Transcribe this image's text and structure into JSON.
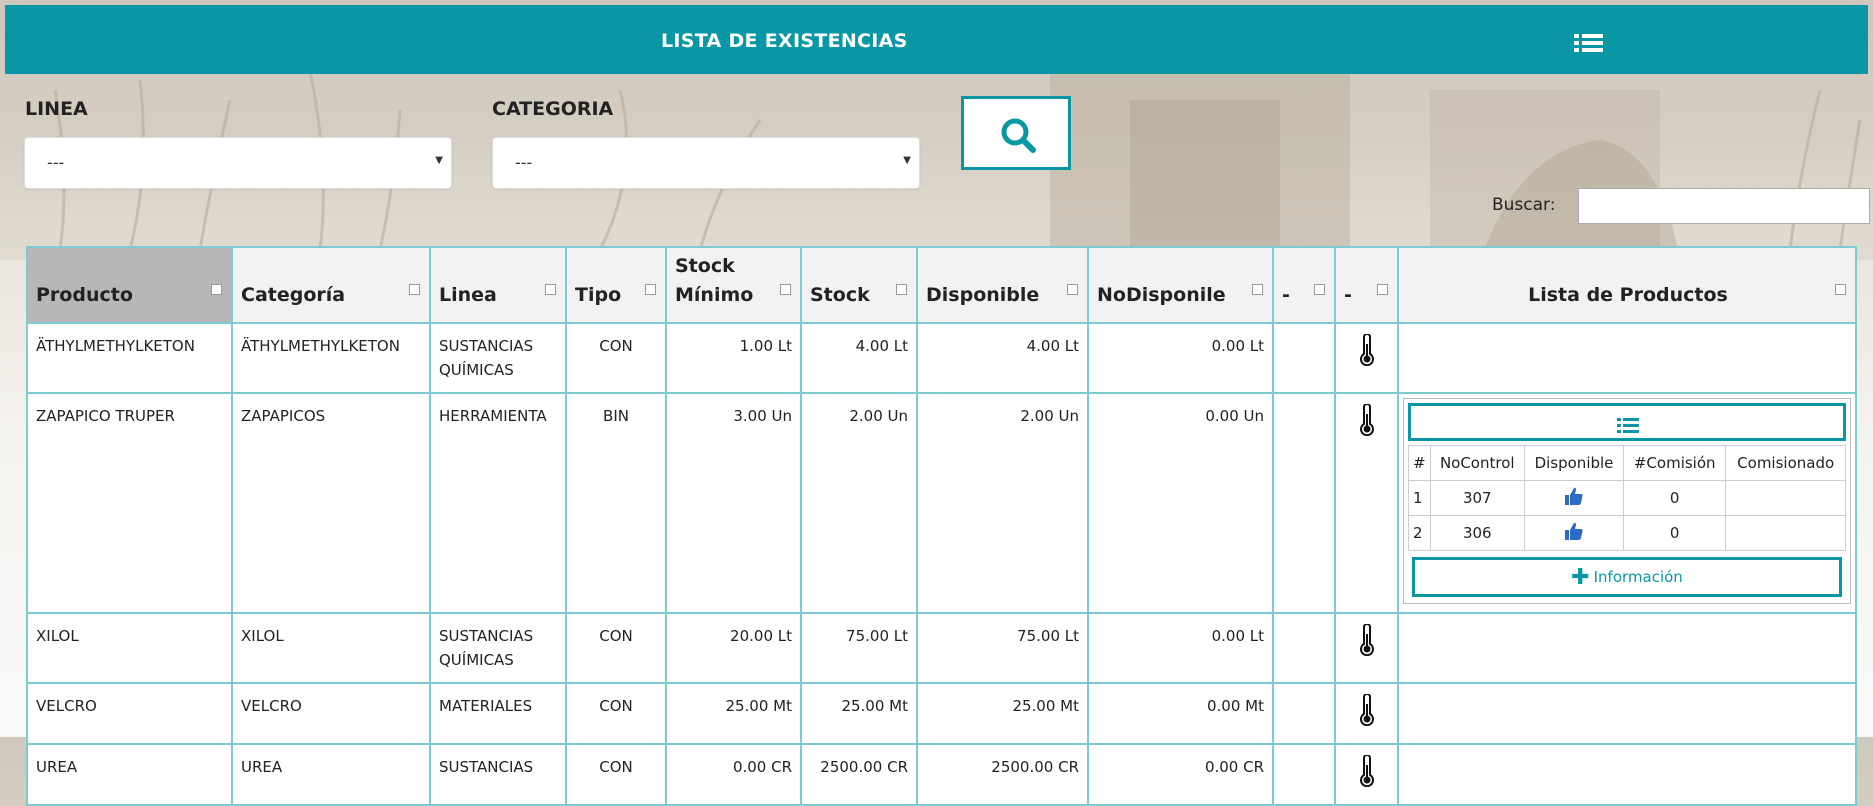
{
  "header": {
    "title": "LISTA DE EXISTENCIAS",
    "menu_icon": "list-icon",
    "accent": "#0a97a5"
  },
  "filters": {
    "linea": {
      "label": "LINEA",
      "value": "---"
    },
    "categoria": {
      "label": "CATEGORIA",
      "value": "---"
    },
    "search_icon": "search-icon"
  },
  "buscar": {
    "label": "Buscar:",
    "value": ""
  },
  "columns": [
    "Producto",
    "Categoría",
    "Linea",
    "Tipo",
    "Stock Mínimo",
    "Stock",
    "Disponible",
    "NoDisponile",
    "-",
    "-",
    "Lista de Productos"
  ],
  "rows": [
    {
      "producto": "ÄTHYLMETHYLKETON",
      "categoria": "ÄTHYLMETHYLKETON",
      "linea": "SUSTANCIAS QUÍMICAS",
      "tipo": "CON",
      "stock_minimo": "1.00 Lt",
      "stock": "4.00 Lt",
      "disponible": "4.00 Lt",
      "nodisponible": "0.00 Lt",
      "status": "green"
    },
    {
      "producto": "ZAPAPICO TRUPER",
      "categoria": "ZAPAPICOS",
      "linea": "HERRAMIENTA",
      "tipo": "BIN",
      "stock_minimo": "3.00 Un",
      "stock": "2.00 Un",
      "disponible": "2.00 Un",
      "nodisponible": "0.00 Un",
      "status": "red"
    },
    {
      "producto": "XILOL",
      "categoria": "XILOL",
      "linea": "SUSTANCIAS QUÍMICAS",
      "tipo": "CON",
      "stock_minimo": "20.00 Lt",
      "stock": "75.00 Lt",
      "disponible": "75.00 Lt",
      "nodisponible": "0.00 Lt",
      "status": "green"
    },
    {
      "producto": "VELCRO",
      "categoria": "VELCRO",
      "linea": "MATERIALES",
      "tipo": "CON",
      "stock_minimo": "25.00 Mt",
      "stock": "25.00 Mt",
      "disponible": "25.00 Mt",
      "nodisponible": "0.00 Mt",
      "status": "yellow"
    },
    {
      "producto": "UREA",
      "categoria": "UREA",
      "linea": "SUSTANCIAS",
      "tipo": "CON",
      "stock_minimo": "0.00 CR",
      "stock": "2500.00 CR",
      "disponible": "2500.00 CR",
      "nodisponible": "0.00 CR",
      "status": "green"
    }
  ],
  "sublist": {
    "columns": [
      "#",
      "NoControl",
      "Disponible",
      "#Comisión",
      "Comisionado"
    ],
    "rows": [
      {
        "n": "1",
        "nocontrol": "307",
        "disponible_icon": "thumbs-up-icon",
        "comision": "0",
        "comisionado": ""
      },
      {
        "n": "2",
        "nocontrol": "306",
        "disponible_icon": "thumbs-up-icon",
        "comision": "0",
        "comisionado": ""
      }
    ],
    "info_label": "Información"
  },
  "status_colors": {
    "green": "#b2f7c3",
    "red": "#fbb3b1",
    "yellow": "#fde69b"
  }
}
